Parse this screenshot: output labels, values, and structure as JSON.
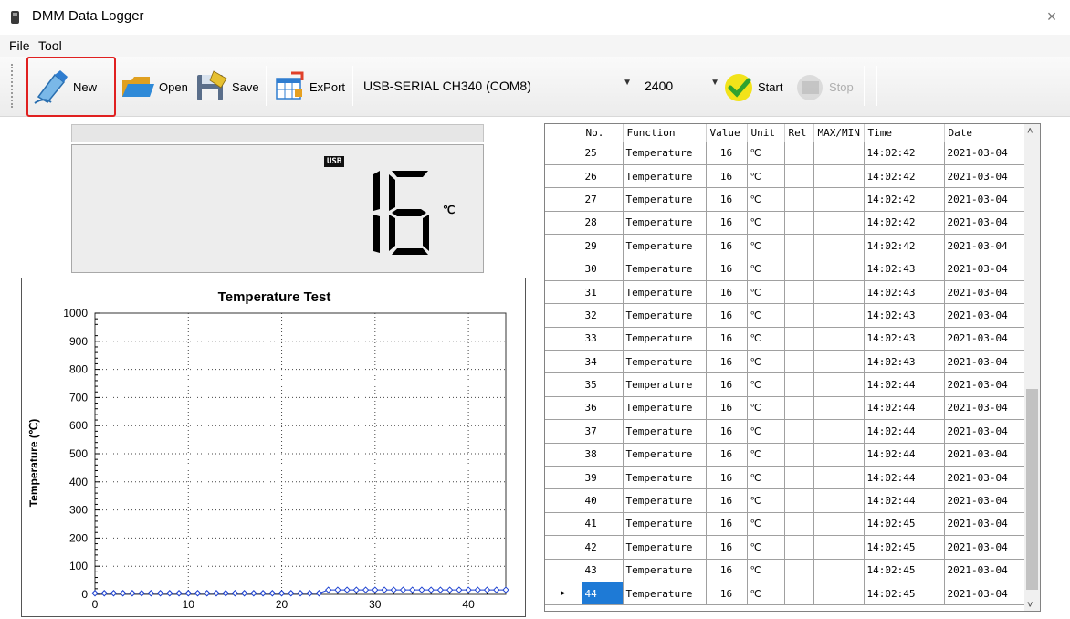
{
  "window": {
    "title": "DMM Data Logger",
    "close_glyph": "×"
  },
  "menu": {
    "items": [
      "File",
      "Tool"
    ]
  },
  "toolbar": {
    "new_label": "New",
    "open_label": "Open",
    "save_label": "Save",
    "export_label": "ExPort",
    "port_value": "USB-SERIAL CH340 (COM8)",
    "baud_value": "2400",
    "start_label": "Start",
    "stop_label": "Stop"
  },
  "display": {
    "usb_badge": "USB",
    "reading": "16",
    "unit": "℃"
  },
  "chart_data": {
    "type": "line",
    "title": "Temperature Test",
    "xlabel": "",
    "ylabel": "Temperature (℃)",
    "xlim": [
      0,
      44
    ],
    "ylim": [
      0,
      1000
    ],
    "xticks": [
      0,
      10,
      20,
      30,
      40
    ],
    "yticks": [
      0,
      100,
      200,
      300,
      400,
      500,
      600,
      700,
      800,
      900,
      1000
    ],
    "grid": true,
    "series": [
      {
        "color": "#1a3fd0",
        "marker": "diamond",
        "x": [
          0,
          1,
          2,
          3,
          4,
          5,
          6,
          7,
          8,
          9,
          10,
          11,
          12,
          13,
          14,
          15,
          16,
          17,
          18,
          19,
          20,
          21,
          22,
          23,
          24,
          25,
          26,
          27,
          28,
          29,
          30,
          31,
          32,
          33,
          34,
          35,
          36,
          37,
          38,
          39,
          40,
          41,
          42,
          43,
          44
        ],
        "values": [
          4,
          4,
          4,
          4,
          4,
          4,
          4,
          4,
          4,
          4,
          4,
          4,
          4,
          4,
          4,
          4,
          4,
          4,
          4,
          4,
          4,
          4,
          4,
          4,
          4,
          16,
          16,
          16,
          16,
          16,
          16,
          16,
          16,
          16,
          16,
          16,
          16,
          16,
          16,
          16,
          16,
          16,
          16,
          16,
          16
        ]
      }
    ]
  },
  "table": {
    "columns": [
      "No.",
      "Function",
      "Value",
      "Unit",
      "Rel",
      "MAX/MIN",
      "Time",
      "Date"
    ],
    "rows": [
      [
        "25",
        "Temperature",
        "16",
        "℃",
        "",
        "",
        "14:02:42",
        "2021-03-04"
      ],
      [
        "26",
        "Temperature",
        "16",
        "℃",
        "",
        "",
        "14:02:42",
        "2021-03-04"
      ],
      [
        "27",
        "Temperature",
        "16",
        "℃",
        "",
        "",
        "14:02:42",
        "2021-03-04"
      ],
      [
        "28",
        "Temperature",
        "16",
        "℃",
        "",
        "",
        "14:02:42",
        "2021-03-04"
      ],
      [
        "29",
        "Temperature",
        "16",
        "℃",
        "",
        "",
        "14:02:42",
        "2021-03-04"
      ],
      [
        "30",
        "Temperature",
        "16",
        "℃",
        "",
        "",
        "14:02:43",
        "2021-03-04"
      ],
      [
        "31",
        "Temperature",
        "16",
        "℃",
        "",
        "",
        "14:02:43",
        "2021-03-04"
      ],
      [
        "32",
        "Temperature",
        "16",
        "℃",
        "",
        "",
        "14:02:43",
        "2021-03-04"
      ],
      [
        "33",
        "Temperature",
        "16",
        "℃",
        "",
        "",
        "14:02:43",
        "2021-03-04"
      ],
      [
        "34",
        "Temperature",
        "16",
        "℃",
        "",
        "",
        "14:02:43",
        "2021-03-04"
      ],
      [
        "35",
        "Temperature",
        "16",
        "℃",
        "",
        "",
        "14:02:44",
        "2021-03-04"
      ],
      [
        "36",
        "Temperature",
        "16",
        "℃",
        "",
        "",
        "14:02:44",
        "2021-03-04"
      ],
      [
        "37",
        "Temperature",
        "16",
        "℃",
        "",
        "",
        "14:02:44",
        "2021-03-04"
      ],
      [
        "38",
        "Temperature",
        "16",
        "℃",
        "",
        "",
        "14:02:44",
        "2021-03-04"
      ],
      [
        "39",
        "Temperature",
        "16",
        "℃",
        "",
        "",
        "14:02:44",
        "2021-03-04"
      ],
      [
        "40",
        "Temperature",
        "16",
        "℃",
        "",
        "",
        "14:02:44",
        "2021-03-04"
      ],
      [
        "41",
        "Temperature",
        "16",
        "℃",
        "",
        "",
        "14:02:45",
        "2021-03-04"
      ],
      [
        "42",
        "Temperature",
        "16",
        "℃",
        "",
        "",
        "14:02:45",
        "2021-03-04"
      ],
      [
        "43",
        "Temperature",
        "16",
        "℃",
        "",
        "",
        "14:02:45",
        "2021-03-04"
      ],
      [
        "44",
        "Temperature",
        "16",
        "℃",
        "",
        "",
        "14:02:45",
        "2021-03-04"
      ]
    ],
    "current_row_marker": "▶",
    "selected_row": 19
  },
  "colors": {
    "accent_highlight": "#e02020",
    "selection": "#1e7ad6",
    "series": "#1a3fd0"
  }
}
